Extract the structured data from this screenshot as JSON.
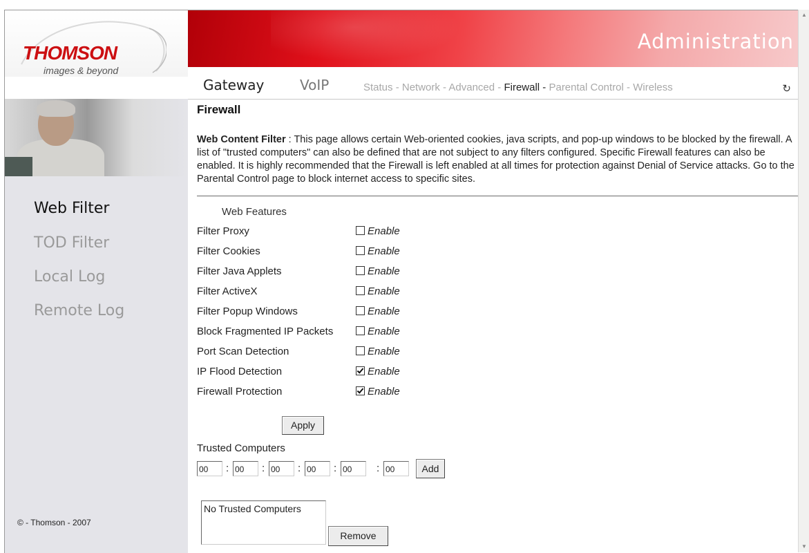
{
  "brand": {
    "logo_text": "THOMSON",
    "tagline": "images & beyond"
  },
  "header": {
    "title": "Administration",
    "nav_main": [
      "Gateway",
      "VoIP"
    ],
    "sub_nav": [
      {
        "label": "Status -",
        "active": false
      },
      {
        "label": "Network -",
        "active": false
      },
      {
        "label": "Advanced -",
        "active": false
      },
      {
        "label": "Firewall -",
        "active": true
      },
      {
        "label": "Parental Control -",
        "active": false
      },
      {
        "label": "Wireless",
        "active": false
      }
    ]
  },
  "sidebar": {
    "items": [
      {
        "label": "Web Filter",
        "active": true
      },
      {
        "label": "TOD Filter",
        "active": false
      },
      {
        "label": "Local Log",
        "active": false
      },
      {
        "label": "Remote Log",
        "active": false
      }
    ],
    "copyright": "© - Thomson - 2007"
  },
  "main": {
    "page_title": "Firewall",
    "desc_heading": "Web Content Filter",
    "desc_sep": " : ",
    "description": "This page allows certain Web-oriented cookies, java scripts, and pop-up windows to be blocked by the firewall. A list of \"trusted computers\" can also be defined that are not subject to any filters configured. Specific Firewall features can also be enabled. It is highly recommended that the Firewall is left enabled at all times for protection against Denial of Service attacks. Go to the Parental Control page to block internet access to specific sites.",
    "features_heading": "Web Features",
    "enable_label": "Enable",
    "features": [
      {
        "label": "Filter Proxy",
        "checked": false
      },
      {
        "label": "Filter Cookies",
        "checked": false
      },
      {
        "label": "Filter Java Applets",
        "checked": false
      },
      {
        "label": "Filter ActiveX",
        "checked": false
      },
      {
        "label": "Filter Popup Windows",
        "checked": false
      },
      {
        "label": "Block Fragmented IP Packets",
        "checked": false
      },
      {
        "label": "Port Scan Detection",
        "checked": false
      },
      {
        "label": "IP Flood Detection",
        "checked": true
      },
      {
        "label": "Firewall Protection",
        "checked": true
      }
    ],
    "apply_label": "Apply",
    "trusted_label": "Trusted Computers",
    "mac_octets": [
      "00",
      "00",
      "00",
      "00",
      "00",
      "00"
    ],
    "add_label": "Add",
    "trusted_list_empty": "No Trusted Computers",
    "remove_label": "Remove"
  },
  "colors": {
    "brand_red": "#cc0f12",
    "sidebar_bg": "#e4e4e9"
  }
}
